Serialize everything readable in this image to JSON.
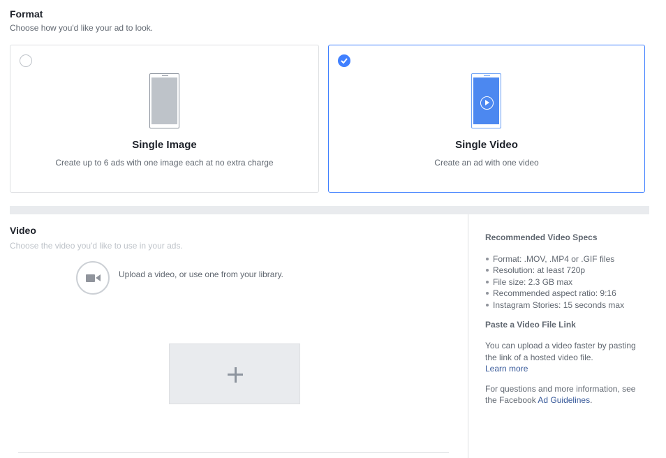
{
  "format": {
    "title": "Format",
    "subtitle": "Choose how you'd like your ad to look.",
    "options": [
      {
        "title": "Single Image",
        "description": "Create up to 6 ads with one image each at no extra charge",
        "selected": false
      },
      {
        "title": "Single Video",
        "description": "Create an ad with one video",
        "selected": true
      }
    ]
  },
  "video": {
    "title": "Video",
    "subtitle": "Choose the video you'd like to use in your ads.",
    "upload_text": "Upload a video, or use one from your library."
  },
  "specs": {
    "title": "Recommended Video Specs",
    "items": [
      "Format: .MOV, .MP4 or .GIF files",
      "Resolution: at least 720p",
      "File size: 2.3 GB max",
      "Recommended aspect ratio: 9:16",
      "Instagram Stories: 15 seconds max"
    ],
    "paste_title": "Paste a Video File Link",
    "paste_text": "You can upload a video faster by pasting the link of a hosted video file.",
    "learn_more": "Learn more",
    "questions_prefix": "For questions and more information, see the Facebook",
    "guidelines_link": "Ad Guidelines",
    "questions_suffix": "."
  },
  "colors": {
    "accent": "#4080ff",
    "link": "#365899",
    "video_screen": "#4c88f0",
    "image_screen": "#bec3c9"
  },
  "icons": {
    "checkmark": "check-icon",
    "camera": "video-camera-icon",
    "add": "plus-icon"
  }
}
